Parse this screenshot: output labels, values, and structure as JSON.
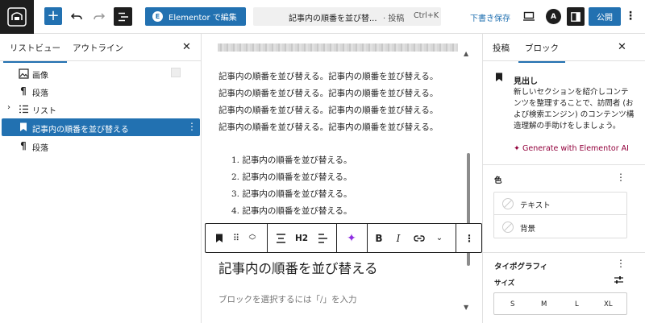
{
  "topbar": {
    "elementor_label": "Elementor で編集",
    "doc_title": "記事内の順番を並び替...",
    "doc_type": "· 投稿",
    "shortcut": "Ctrl+K",
    "save_draft": "下書き保存",
    "publish": "公開",
    "avatar_letter": "A"
  },
  "left_panel": {
    "tabs": [
      "リストビュー",
      "アウトライン"
    ],
    "items": [
      {
        "label": "画像",
        "icon": "image-icon"
      },
      {
        "label": "段落",
        "icon": "paragraph-icon"
      },
      {
        "label": "リスト",
        "icon": "list-icon"
      },
      {
        "label": "記事内の順番を並び替える",
        "icon": "heading-bookmark-icon"
      },
      {
        "label": "段落",
        "icon": "paragraph-icon"
      }
    ]
  },
  "canvas": {
    "paragraph_lines": [
      "記事内の順番を並び替える。記事内の順番を並び替える。",
      "記事内の順番を並び替える。記事内の順番を並び替える。",
      "記事内の順番を並び替える。記事内の順番を並び替える。",
      "記事内の順番を並び替える。記事内の順番を並び替える。"
    ],
    "list_items": [
      "1. 記事内の順番を並び替える。",
      "2. 記事内の順番を並び替える。",
      "3. 記事内の順番を並び替える。",
      "4. 記事内の順番を並び替える。"
    ],
    "heading": "記事内の順番を並び替える",
    "placeholder": "ブロックを選択するには「/」を入力"
  },
  "toolbar": {
    "heading_level": "H2",
    "bold": "B",
    "italic": "I"
  },
  "right_panel": {
    "tabs": [
      "投稿",
      "ブロック"
    ],
    "block_title": "見出し",
    "block_desc": "新しいセクションを紹介しコンテンツを整理することで、訪問者 (および検索エンジン) のコンテンツ構造理解の手助けをしましょう。",
    "generate_ai": "Generate with Elementor AI",
    "color_section": "色",
    "color_items": [
      "テキスト",
      "背景"
    ],
    "typography_section": "タイポグラフィ",
    "size_label": "サイズ",
    "size_options": [
      "S",
      "M",
      "L",
      "XL"
    ]
  },
  "colors": {
    "accent": "#2271b1",
    "dark": "#1e1e1e",
    "ai_accent": "#92003b"
  }
}
